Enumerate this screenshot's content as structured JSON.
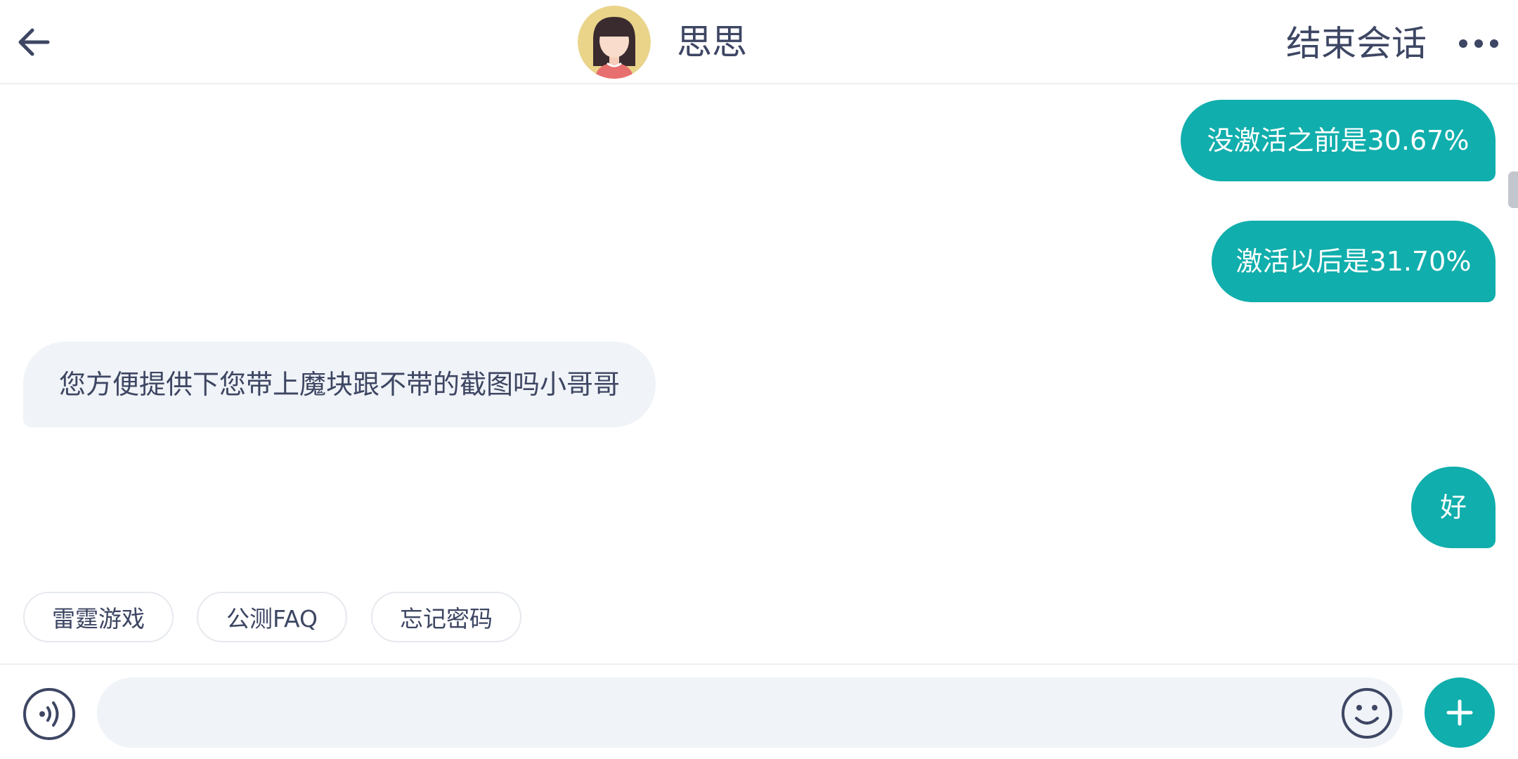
{
  "header": {
    "agent_name": "思思",
    "end_chat_label": "结束会话"
  },
  "messages": [
    {
      "sender": "user",
      "text": "没激活之前是30.67%"
    },
    {
      "sender": "user",
      "text": "激活以后是31.70%"
    },
    {
      "sender": "agent",
      "text": "您方便提供下您带上魔块跟不带的截图吗小哥哥"
    },
    {
      "sender": "user",
      "text": "好"
    }
  ],
  "quick_replies": [
    "雷霆游戏",
    "公测FAQ",
    "忘记密码"
  ],
  "input": {
    "placeholder": "",
    "value": ""
  },
  "icons": {
    "back": "arrow-left-icon",
    "more": "more-dots-icon",
    "voice": "voice-icon",
    "emoji": "smiley-icon",
    "plus": "plus-icon"
  },
  "colors": {
    "accent": "#10aeac",
    "agent_bubble": "#f0f3f7",
    "text": "#3d4663"
  }
}
